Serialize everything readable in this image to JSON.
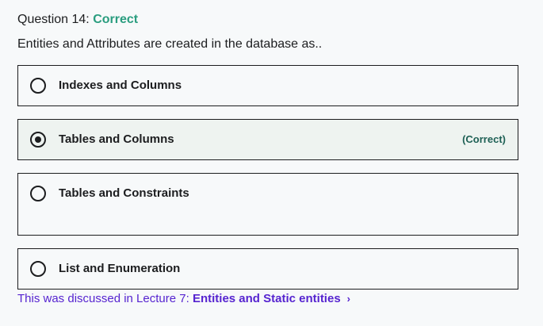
{
  "question": {
    "number_label": "Question 14:",
    "status": "Correct",
    "prompt": "Entities and Attributes are created in the database as.."
  },
  "options": [
    {
      "label": "Indexes and Columns",
      "selected": false
    },
    {
      "label": "Tables and Columns",
      "selected": true,
      "tag": "(Correct)"
    },
    {
      "label": "Tables and Constraints",
      "selected": false
    },
    {
      "label": "List and Enumeration",
      "selected": false
    }
  ],
  "footer": {
    "text": "This was discussed in Lecture 7:",
    "link": "Entities and Static entities",
    "chevron": "›"
  },
  "colors": {
    "correct": "#1e6055",
    "link": "#5624d0"
  },
  "icons": {
    "radio": "radio-icon",
    "chevron": "chevron-right-icon"
  }
}
